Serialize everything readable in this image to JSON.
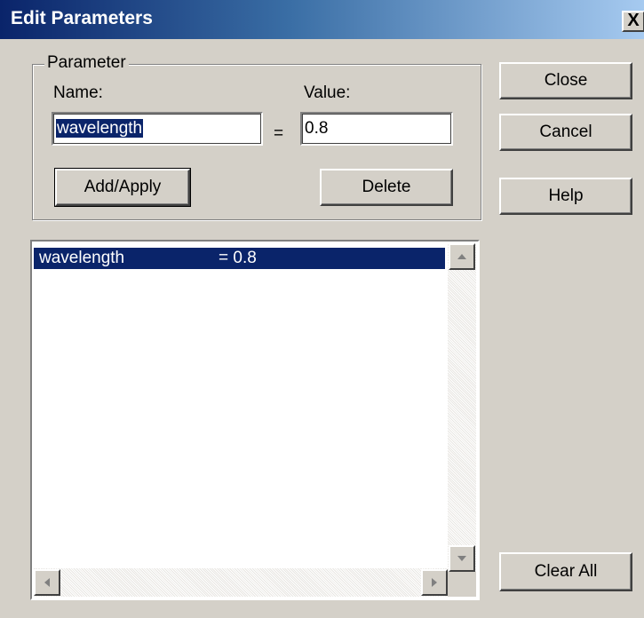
{
  "window": {
    "title": "Edit Parameters",
    "close_glyph": "X"
  },
  "parameter_group": {
    "legend": "Parameter",
    "name_label": "Name:",
    "value_label": "Value:",
    "equals": "=",
    "name_value": "wavelength",
    "value_value": "0.8",
    "add_apply_label": "Add/Apply",
    "delete_label": "Delete"
  },
  "side_buttons": {
    "close_label": "Close",
    "cancel_label": "Cancel",
    "help_label": "Help",
    "clear_all_label": "Clear All"
  },
  "list": {
    "items": [
      {
        "name": "wavelength",
        "value": "= 0.8",
        "selected": true
      }
    ]
  },
  "colors": {
    "face": "#d4d0c8",
    "selection": "#0a246a",
    "title_gradient_start": "#0a246a",
    "title_gradient_end": "#a6caf0"
  },
  "icons": {
    "scroll_up": "arrow-up-icon",
    "scroll_down": "arrow-down-icon",
    "scroll_left": "arrow-left-icon",
    "scroll_right": "arrow-right-icon"
  }
}
